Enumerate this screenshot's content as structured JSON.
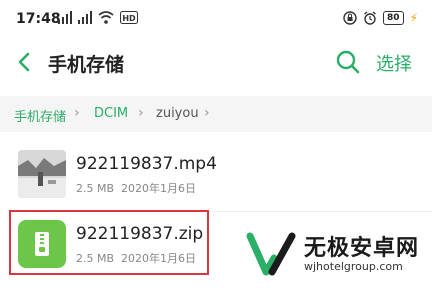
{
  "status_bar": {
    "time": "17:48",
    "battery": "80"
  },
  "app_bar": {
    "title": "手机存储",
    "select_label": "选择"
  },
  "breadcrumb": {
    "items": [
      "手机存储",
      "DCIM",
      "zuiyou"
    ]
  },
  "files": [
    {
      "name": "922119837.mp4",
      "size": "2.5 MB",
      "date": "2020年1月6日",
      "icon": "video-thumbnail"
    },
    {
      "name": "922119837.zip",
      "size": "2.5 MB",
      "date": "2020年1月6日",
      "icon": "zip-archive-icon"
    }
  ],
  "watermark": {
    "title": "无极安卓网",
    "url": "wjhotelgroup.com"
  },
  "colors": {
    "accent": "#2bae66",
    "highlight": "#d9363e",
    "zip_icon": "#6cc64a"
  }
}
